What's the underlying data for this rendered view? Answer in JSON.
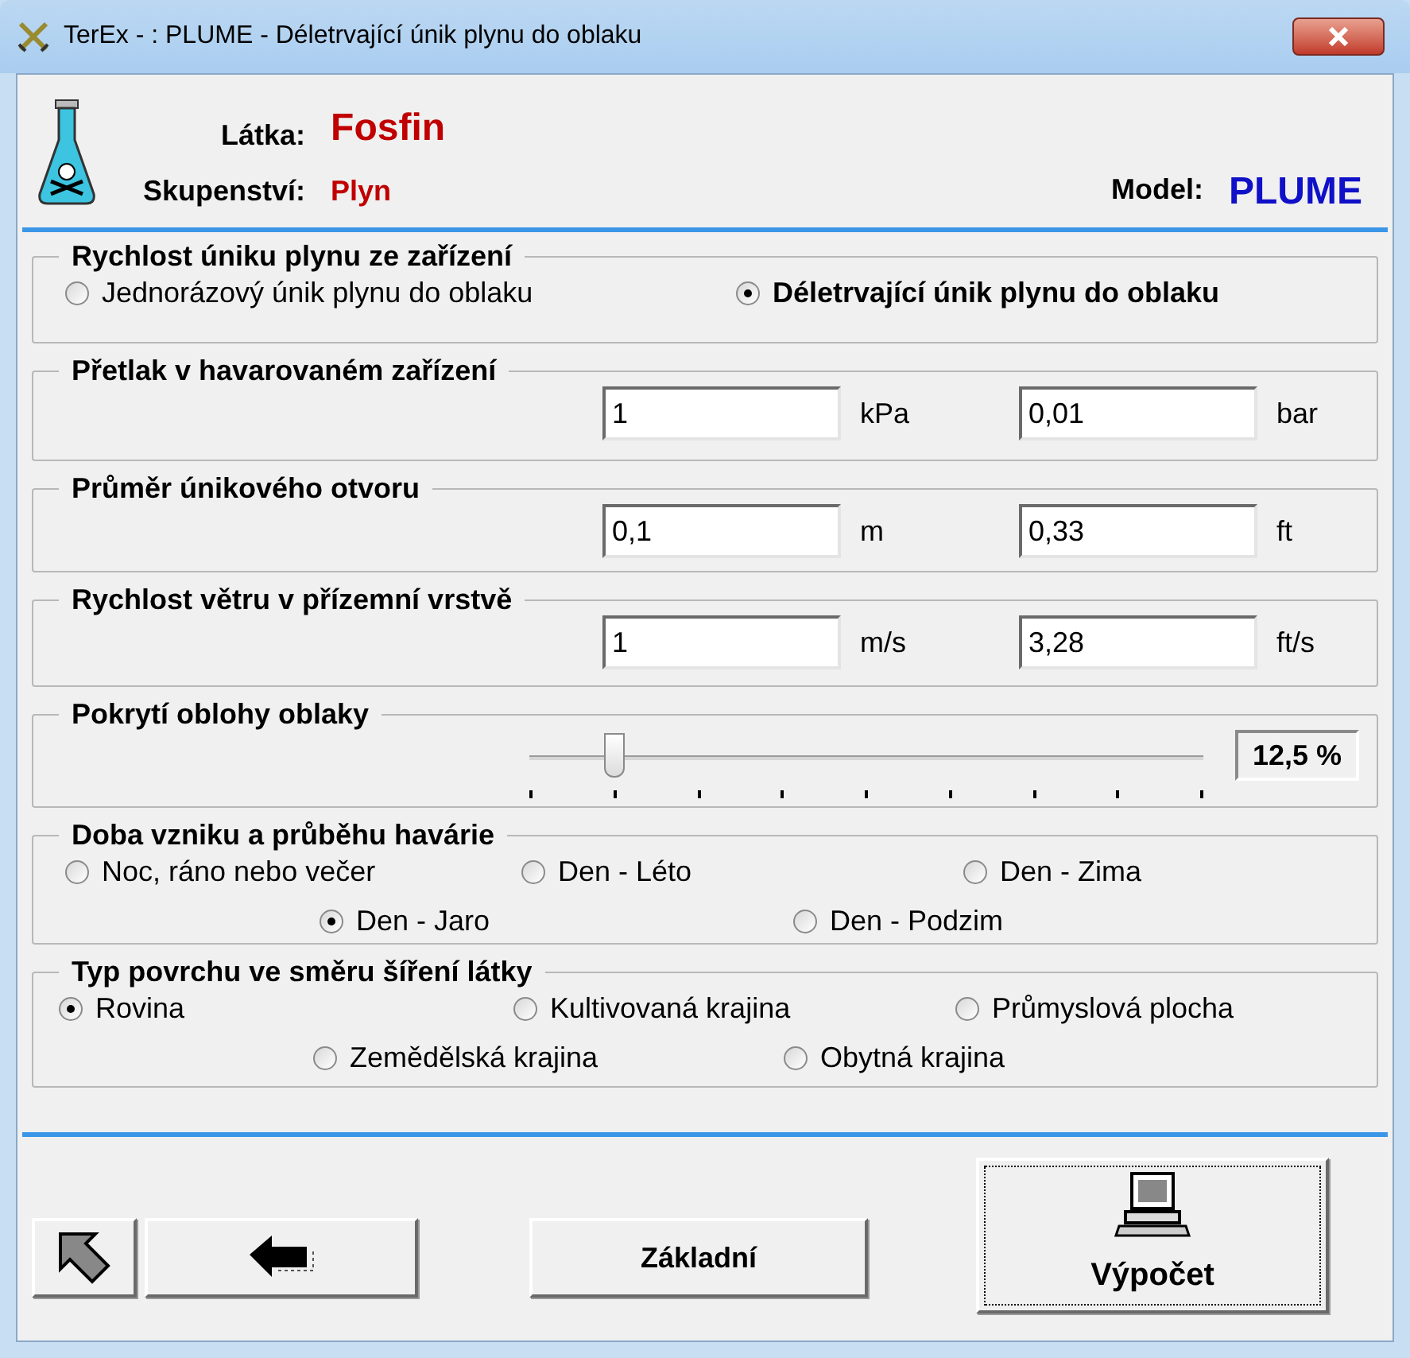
{
  "window": {
    "title": "TerEx - : PLUME - Déletrvající únik plynu do oblaku"
  },
  "header": {
    "substance_label": "Látka:",
    "substance": "Fosfin",
    "state_label": "Skupenství:",
    "state": "Plyn",
    "model_label": "Model:",
    "model": "PLUME"
  },
  "groups": [
    {
      "kind": "radio",
      "title": "Rychlost úniku plynu ze zařízení",
      "highlight_selected": true,
      "rows": [
        [
          {
            "label": "Jednorázový únik plynu do oblaku",
            "selected": false
          },
          {
            "label": "Déletrvající únik plynu do oblaku",
            "selected": true
          }
        ]
      ]
    },
    {
      "kind": "fields",
      "title": "Přetlak v havarovaném zařízení",
      "fields": [
        {
          "value": "1",
          "unit": "kPa"
        },
        {
          "value": "0,01",
          "unit": "bar"
        }
      ]
    },
    {
      "kind": "fields",
      "title": "Průměr únikového otvoru",
      "fields": [
        {
          "value": "0,1",
          "unit": "m"
        },
        {
          "value": "0,33",
          "unit": "ft"
        }
      ]
    },
    {
      "kind": "fields",
      "title": "Rychlost větru v přízemní vrstvě",
      "fields": [
        {
          "value": "1",
          "unit": "m/s"
        },
        {
          "value": "3,28",
          "unit": "ft/s"
        }
      ]
    },
    {
      "kind": "slider",
      "title": "Pokrytí oblohy oblaky",
      "level": 0.125,
      "reading": "12,5 %"
    },
    {
      "kind": "radio",
      "title": "Doba vzniku a průběhu havárie",
      "highlight_selected": false,
      "rows": [
        [
          {
            "label": "Noc, ráno nebo večer",
            "selected": false
          },
          {
            "label": "Den - Léto",
            "selected": false
          },
          {
            "label": "Den - Zima",
            "selected": false
          }
        ],
        [
          {
            "label": "Den - Jaro",
            "selected": true
          },
          {
            "label": "Den - Podzim",
            "selected": false
          }
        ]
      ]
    },
    {
      "kind": "radio",
      "title": "Typ povrchu ve směru šíření látky",
      "highlight_selected": false,
      "rows": [
        [
          {
            "label": "Rovina",
            "selected": true
          },
          {
            "label": "Kultivovaná krajina",
            "selected": false
          },
          {
            "label": "Průmyslová plocha",
            "selected": false
          }
        ],
        [
          {
            "label": "Zemědělská krajina",
            "selected": false
          },
          {
            "label": "Obytná krajina",
            "selected": false
          }
        ]
      ]
    }
  ],
  "buttons": [
    {
      "kind": "text",
      "label": "Základní"
    },
    {
      "kind": "computer",
      "label": "Výpočet"
    }
  ]
}
